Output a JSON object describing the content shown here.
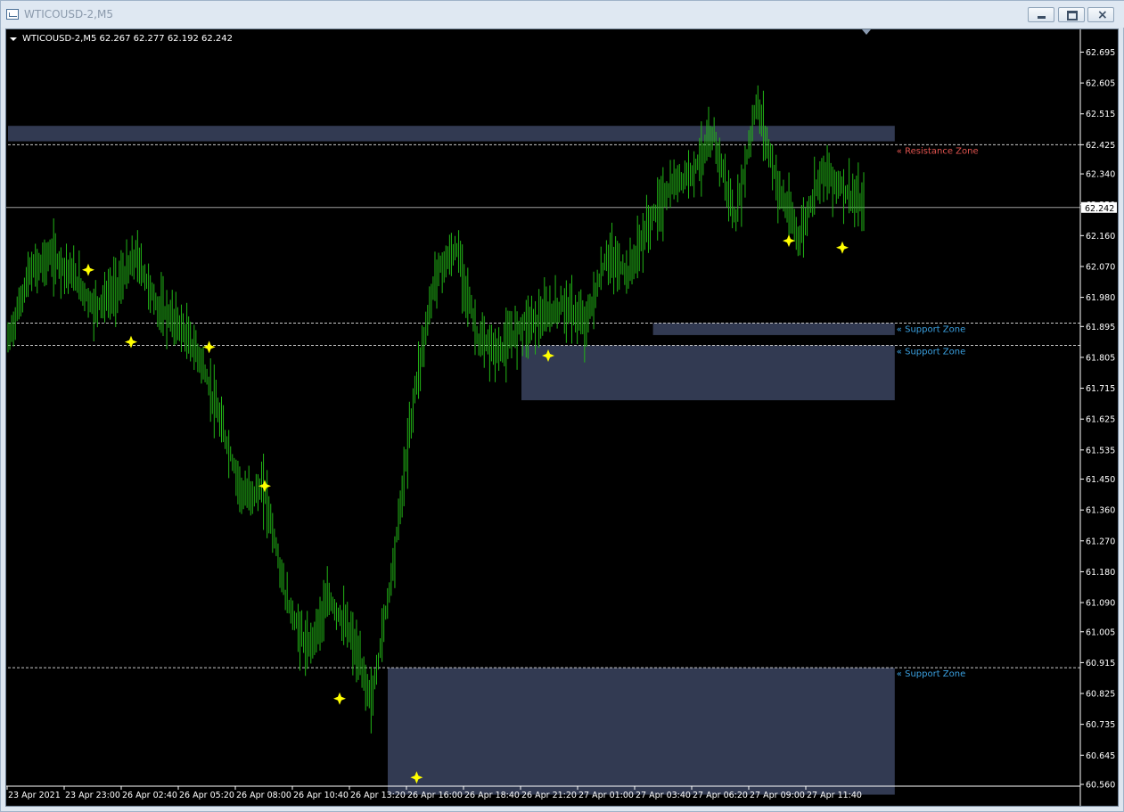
{
  "window": {
    "title": "WTICOUSD-2,M5"
  },
  "chart_header": {
    "text": "WTICOUSD-2,M5  62.267 62.277 62.192 62.242"
  },
  "colors": {
    "background": "#000000",
    "candles": "#22b516",
    "zone_fill": "#323a52",
    "resistance_label": "#e2544f",
    "support_label": "#3aa0e0",
    "marker": "#ffff00",
    "axis_text": "#ffffff"
  },
  "price_axis": {
    "ticks": [
      "62.695",
      "62.605",
      "62.515",
      "62.425",
      "62.340",
      "62.250",
      "62.160",
      "62.070",
      "61.980",
      "61.895",
      "61.805",
      "61.715",
      "61.625",
      "61.535",
      "61.450",
      "61.360",
      "61.270",
      "61.180",
      "61.090",
      "61.005",
      "60.915",
      "60.825",
      "60.735",
      "60.645",
      "60.560"
    ],
    "current_price": "62.242"
  },
  "time_axis": {
    "ticks": [
      "23 Apr 2021",
      "23 Apr 23:00",
      "26 Apr 02:40",
      "26 Apr 05:20",
      "26 Apr 08:00",
      "26 Apr 10:40",
      "26 Apr 13:20",
      "26 Apr 16:00",
      "26 Apr 18:40",
      "26 Apr 21:20",
      "27 Apr 01:00",
      "27 Apr 03:40",
      "27 Apr 06:20",
      "27 Apr 09:00",
      "27 Apr 11:40"
    ]
  },
  "zones": [
    {
      "type": "resistance",
      "label": "« Resistance Zone",
      "top": 62.48,
      "bottom": 62.435,
      "line": 62.425,
      "start": 0,
      "end": 0.829
    },
    {
      "type": "support",
      "label": "« Support Zone",
      "top": 61.905,
      "bottom": 61.87,
      "line": 61.905,
      "start": 0.603,
      "end": 0.829
    },
    {
      "type": "support",
      "label": "« Support Zone",
      "top": 61.84,
      "bottom": 61.68,
      "line": 61.84,
      "start": 0.48,
      "end": 0.829
    },
    {
      "type": "support",
      "label": "« Support Zone",
      "top": 60.9,
      "bottom": 60.53,
      "line": 60.9,
      "start": 0.355,
      "end": 0.829
    }
  ],
  "chart_data": {
    "type": "line",
    "symbol": "WTICOUSD-2",
    "timeframe": "M5",
    "ohlc_last": {
      "open": 62.267,
      "high": 62.277,
      "low": 62.192,
      "close": 62.242
    },
    "ylim": [
      60.56,
      62.73
    ],
    "x": [
      0,
      0.02,
      0.04,
      0.06,
      0.08,
      0.1,
      0.12,
      0.14,
      0.16,
      0.18,
      0.2,
      0.22,
      0.24,
      0.26,
      0.28,
      0.3,
      0.32,
      0.34,
      0.36,
      0.38,
      0.4,
      0.42,
      0.44,
      0.46,
      0.48,
      0.5,
      0.52,
      0.54,
      0.56,
      0.58,
      0.6,
      0.62,
      0.64,
      0.66,
      0.68,
      0.7,
      0.72,
      0.74,
      0.76,
      0.78,
      0.8
    ],
    "close": [
      61.85,
      62.05,
      62.1,
      62.05,
      61.95,
      62.0,
      62.1,
      61.95,
      61.9,
      61.8,
      61.6,
      61.4,
      61.42,
      61.1,
      60.95,
      61.1,
      61.0,
      60.8,
      61.2,
      61.7,
      62.05,
      62.12,
      61.85,
      61.82,
      61.9,
      61.92,
      61.96,
      61.9,
      62.1,
      62.05,
      62.2,
      62.3,
      62.35,
      62.45,
      62.2,
      62.55,
      62.3,
      62.15,
      62.35,
      62.3,
      62.24
    ],
    "swing_markers": [
      {
        "x": 0.075,
        "y": 62.06
      },
      {
        "x": 0.115,
        "y": 61.85
      },
      {
        "x": 0.188,
        "y": 61.835
      },
      {
        "x": 0.24,
        "y": 61.43
      },
      {
        "x": 0.31,
        "y": 60.81
      },
      {
        "x": 0.382,
        "y": 60.58
      },
      {
        "x": 0.505,
        "y": 61.81
      },
      {
        "x": 0.73,
        "y": 62.145
      },
      {
        "x": 0.78,
        "y": 62.125
      }
    ]
  }
}
